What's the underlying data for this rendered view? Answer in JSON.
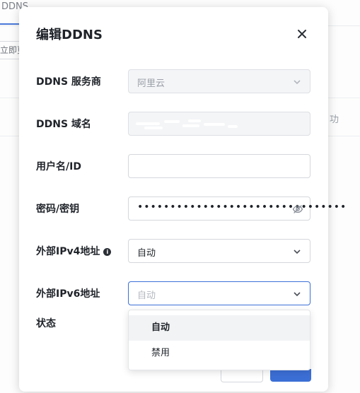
{
  "background": {
    "tab_label": "DDNS",
    "button_partial": "立即更",
    "right_text_partial": "功"
  },
  "dialog": {
    "title": "编辑DDNS",
    "close_icon": "close-icon",
    "provider": {
      "label": "DDNS 服务商",
      "value": "阿里云",
      "disabled": true
    },
    "domain": {
      "label": "DDNS 域名",
      "value_redacted": true,
      "disabled": true
    },
    "username": {
      "label": "用户名/ID",
      "value": ""
    },
    "password": {
      "label": "密码/密钥",
      "value": "••••••••••••••••••••••••••••••••",
      "icon": "eye-off-icon"
    },
    "ipv4": {
      "label": "外部IPv4地址",
      "info_icon": "info-icon",
      "value": "自动"
    },
    "ipv6": {
      "label": "外部IPv6地址",
      "placeholder": "自动",
      "focused": true
    },
    "status": {
      "label": "状态"
    },
    "dropdown": {
      "options": [
        {
          "label": "自动",
          "active": true
        },
        {
          "label": "禁用",
          "active": false
        }
      ]
    }
  },
  "colors": {
    "accent": "#3c6fd6",
    "text_primary": "#1f2329",
    "text_muted": "#9aa0a8",
    "disabled_bg": "#f4f5f7"
  }
}
